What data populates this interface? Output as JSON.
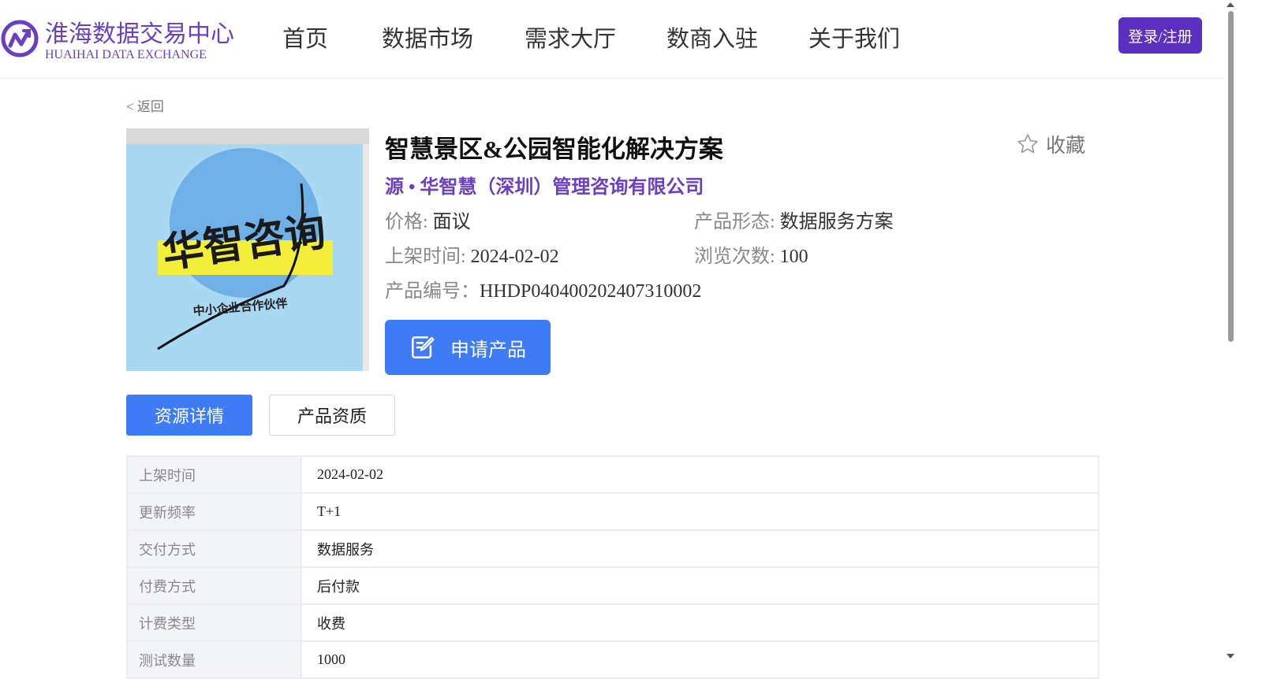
{
  "header": {
    "logo_cn": "淮海数据交易中心",
    "logo_en": "HUAIHAI DATA EXCHANGE",
    "nav": [
      "首页",
      "数据市场",
      "需求大厅",
      "数商入驻",
      "关于我们"
    ],
    "login_label": "登录/注册"
  },
  "back_label": "< 返回",
  "product": {
    "image_text_main": "华智咨询",
    "image_text_sub": "中小企业合作伙伴",
    "title": "智慧景区&公园智能化解决方案",
    "favorite_label": "收藏",
    "company": "源 • 华智慧（深圳）管理咨询有限公司",
    "price_label": "价格:",
    "price_value": "面议",
    "form_label": "产品形态:",
    "form_value": "数据服务方案",
    "listed_label": "上架时间:",
    "listed_value": "2024-02-02",
    "views_label": "浏览次数:",
    "views_value": "100",
    "code_label": "产品编号：",
    "code_value": "HHDP040400202407310002",
    "apply_label": "申请产品"
  },
  "tabs": [
    "资源详情",
    "产品资质"
  ],
  "details": [
    {
      "label": "上架时间",
      "value": "2024-02-02"
    },
    {
      "label": "更新频率",
      "value": "T+1"
    },
    {
      "label": "交付方式",
      "value": "数据服务"
    },
    {
      "label": "付费方式",
      "value": "后付款"
    },
    {
      "label": "计费类型",
      "value": "收费"
    },
    {
      "label": "测试数量",
      "value": "1000"
    }
  ],
  "colors": {
    "brand": "#6b3fc2",
    "primary": "#3e7bf6"
  },
  "icons": [
    "logo-icon",
    "star-icon",
    "edit-icon"
  ]
}
